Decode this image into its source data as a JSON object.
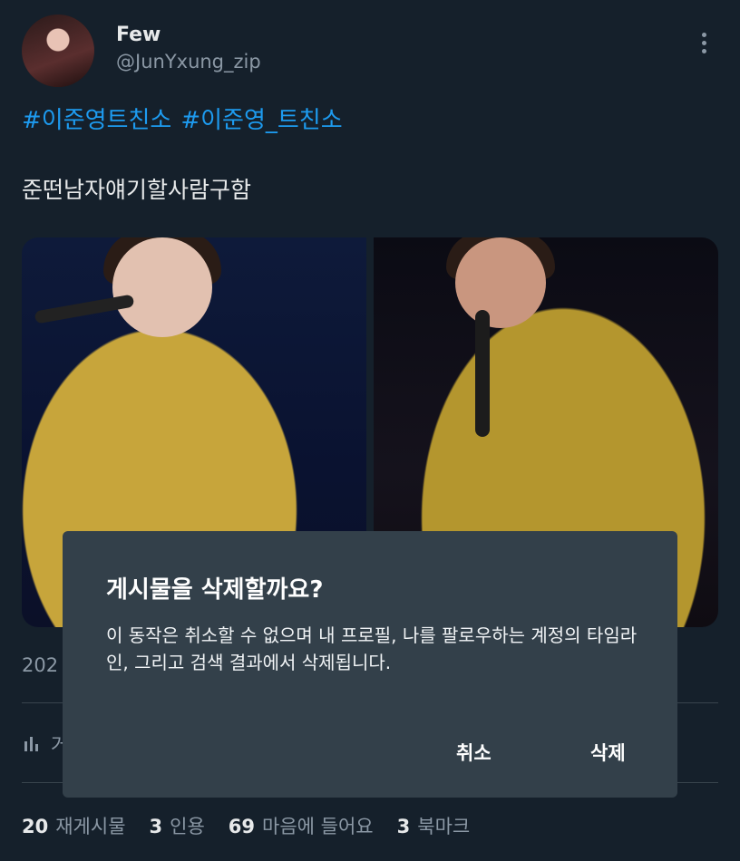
{
  "author": {
    "name": "Few",
    "handle": "@JunYxung_zip"
  },
  "tweet": {
    "hashtags": [
      "#이준영트친소",
      "#이준영_트친소"
    ],
    "text": "준떤남자얘기할사람구함",
    "date_partial": "202",
    "views_partial": "거"
  },
  "stats": [
    {
      "count": "20",
      "label": "재게시물"
    },
    {
      "count": "3",
      "label": "인용"
    },
    {
      "count": "69",
      "label": "마음에 들어요"
    },
    {
      "count": "3",
      "label": "북마크"
    }
  ],
  "dialog": {
    "title": "게시물을 삭제할까요?",
    "message": "이 동작은 취소할 수 없으며 내 프로필, 나를 팔로우하는 계정의 타임라인, 그리고 검색 결과에서 삭제됩니다.",
    "cancel_label": "취소",
    "delete_label": "삭제"
  },
  "colors": {
    "background": "#15202b",
    "link": "#1d9bf0",
    "muted": "#8b98a5",
    "dialog_bg": "#33404a"
  },
  "icons": {
    "more": "more-vertical-icon",
    "views": "bar-chart-icon"
  }
}
